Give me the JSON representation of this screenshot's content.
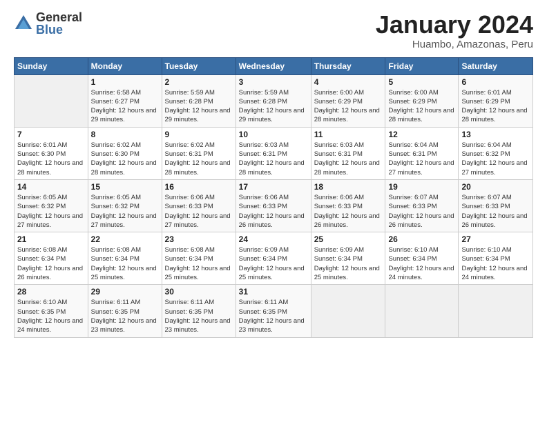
{
  "logo": {
    "general": "General",
    "blue": "Blue"
  },
  "title": "January 2024",
  "subtitle": "Huambo, Amazonas, Peru",
  "headers": [
    "Sunday",
    "Monday",
    "Tuesday",
    "Wednesday",
    "Thursday",
    "Friday",
    "Saturday"
  ],
  "weeks": [
    [
      {
        "num": "",
        "empty": true
      },
      {
        "num": "1",
        "sunrise": "6:58 AM",
        "sunset": "6:27 PM",
        "daylight": "12 hours and 29 minutes."
      },
      {
        "num": "2",
        "sunrise": "5:59 AM",
        "sunset": "6:28 PM",
        "daylight": "12 hours and 29 minutes."
      },
      {
        "num": "3",
        "sunrise": "5:59 AM",
        "sunset": "6:28 PM",
        "daylight": "12 hours and 29 minutes."
      },
      {
        "num": "4",
        "sunrise": "6:00 AM",
        "sunset": "6:29 PM",
        "daylight": "12 hours and 28 minutes."
      },
      {
        "num": "5",
        "sunrise": "6:00 AM",
        "sunset": "6:29 PM",
        "daylight": "12 hours and 28 minutes."
      },
      {
        "num": "6",
        "sunrise": "6:01 AM",
        "sunset": "6:29 PM",
        "daylight": "12 hours and 28 minutes."
      }
    ],
    [
      {
        "num": "7",
        "sunrise": "6:01 AM",
        "sunset": "6:30 PM",
        "daylight": "12 hours and 28 minutes."
      },
      {
        "num": "8",
        "sunrise": "6:02 AM",
        "sunset": "6:30 PM",
        "daylight": "12 hours and 28 minutes."
      },
      {
        "num": "9",
        "sunrise": "6:02 AM",
        "sunset": "6:31 PM",
        "daylight": "12 hours and 28 minutes."
      },
      {
        "num": "10",
        "sunrise": "6:03 AM",
        "sunset": "6:31 PM",
        "daylight": "12 hours and 28 minutes."
      },
      {
        "num": "11",
        "sunrise": "6:03 AM",
        "sunset": "6:31 PM",
        "daylight": "12 hours and 28 minutes."
      },
      {
        "num": "12",
        "sunrise": "6:04 AM",
        "sunset": "6:31 PM",
        "daylight": "12 hours and 27 minutes."
      },
      {
        "num": "13",
        "sunrise": "6:04 AM",
        "sunset": "6:32 PM",
        "daylight": "12 hours and 27 minutes."
      }
    ],
    [
      {
        "num": "14",
        "sunrise": "6:05 AM",
        "sunset": "6:32 PM",
        "daylight": "12 hours and 27 minutes."
      },
      {
        "num": "15",
        "sunrise": "6:05 AM",
        "sunset": "6:32 PM",
        "daylight": "12 hours and 27 minutes."
      },
      {
        "num": "16",
        "sunrise": "6:06 AM",
        "sunset": "6:33 PM",
        "daylight": "12 hours and 27 minutes."
      },
      {
        "num": "17",
        "sunrise": "6:06 AM",
        "sunset": "6:33 PM",
        "daylight": "12 hours and 26 minutes."
      },
      {
        "num": "18",
        "sunrise": "6:06 AM",
        "sunset": "6:33 PM",
        "daylight": "12 hours and 26 minutes."
      },
      {
        "num": "19",
        "sunrise": "6:07 AM",
        "sunset": "6:33 PM",
        "daylight": "12 hours and 26 minutes."
      },
      {
        "num": "20",
        "sunrise": "6:07 AM",
        "sunset": "6:33 PM",
        "daylight": "12 hours and 26 minutes."
      }
    ],
    [
      {
        "num": "21",
        "sunrise": "6:08 AM",
        "sunset": "6:34 PM",
        "daylight": "12 hours and 26 minutes."
      },
      {
        "num": "22",
        "sunrise": "6:08 AM",
        "sunset": "6:34 PM",
        "daylight": "12 hours and 25 minutes."
      },
      {
        "num": "23",
        "sunrise": "6:08 AM",
        "sunset": "6:34 PM",
        "daylight": "12 hours and 25 minutes."
      },
      {
        "num": "24",
        "sunrise": "6:09 AM",
        "sunset": "6:34 PM",
        "daylight": "12 hours and 25 minutes."
      },
      {
        "num": "25",
        "sunrise": "6:09 AM",
        "sunset": "6:34 PM",
        "daylight": "12 hours and 25 minutes."
      },
      {
        "num": "26",
        "sunrise": "6:10 AM",
        "sunset": "6:34 PM",
        "daylight": "12 hours and 24 minutes."
      },
      {
        "num": "27",
        "sunrise": "6:10 AM",
        "sunset": "6:34 PM",
        "daylight": "12 hours and 24 minutes."
      }
    ],
    [
      {
        "num": "28",
        "sunrise": "6:10 AM",
        "sunset": "6:35 PM",
        "daylight": "12 hours and 24 minutes."
      },
      {
        "num": "29",
        "sunrise": "6:11 AM",
        "sunset": "6:35 PM",
        "daylight": "12 hours and 23 minutes."
      },
      {
        "num": "30",
        "sunrise": "6:11 AM",
        "sunset": "6:35 PM",
        "daylight": "12 hours and 23 minutes."
      },
      {
        "num": "31",
        "sunrise": "6:11 AM",
        "sunset": "6:35 PM",
        "daylight": "12 hours and 23 minutes."
      },
      {
        "num": "",
        "empty": true
      },
      {
        "num": "",
        "empty": true
      },
      {
        "num": "",
        "empty": true
      }
    ]
  ]
}
